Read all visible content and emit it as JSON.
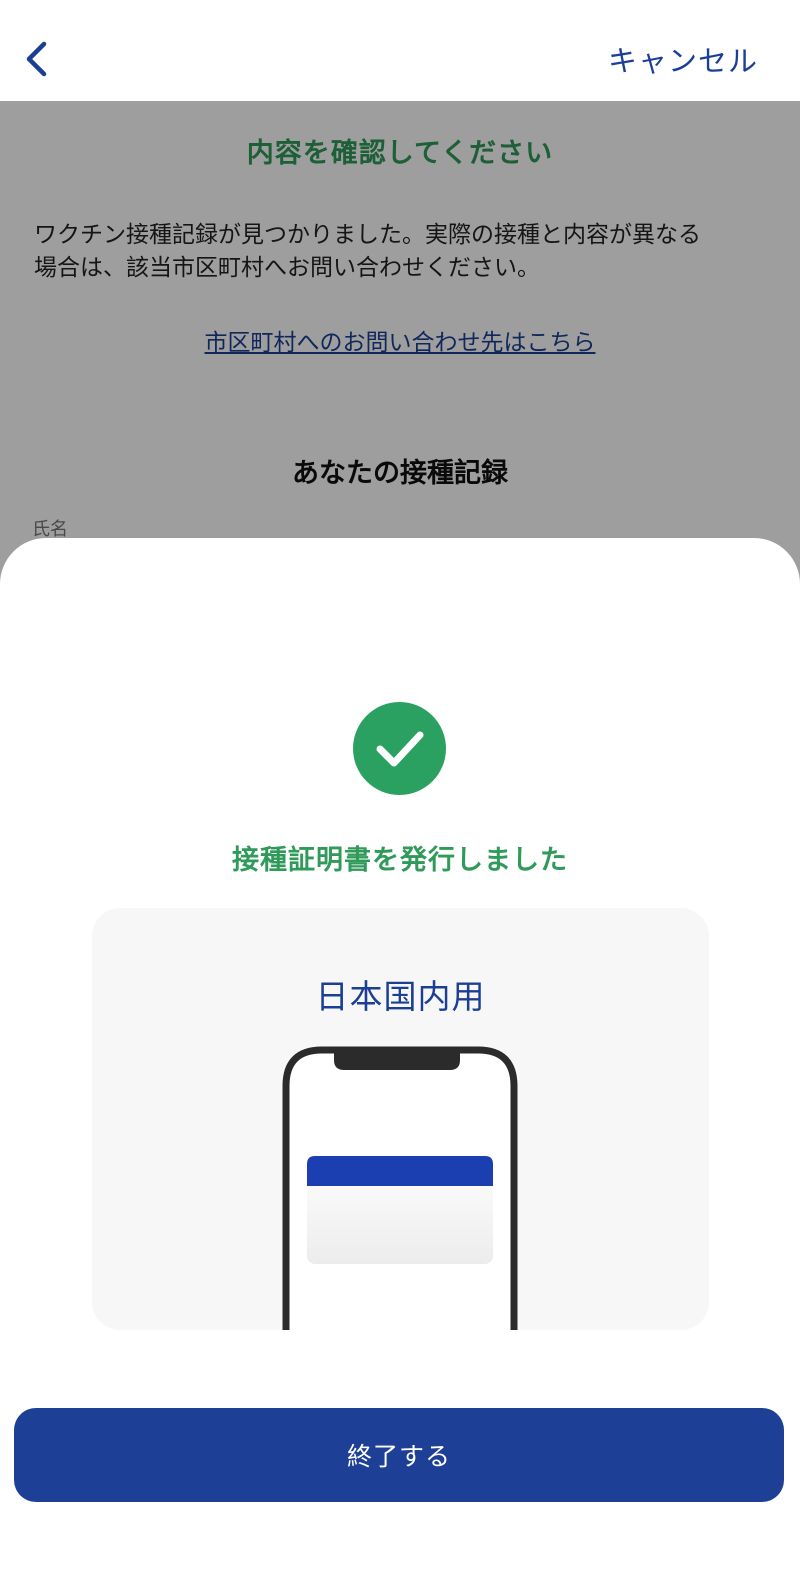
{
  "nav": {
    "back_icon": "chevron-left-icon",
    "cancel_label": "キャンセル"
  },
  "background": {
    "title": "内容を確認してください",
    "description_line1": "ワクチン接種記録が見つかりました。実際の接種と内容が異なる",
    "description_line2": "場合は、該当市区町村へお問い合わせください。",
    "contact_link": "市区町村へのお問い合わせ先はこちら",
    "record_heading": "あなたの接種記録",
    "name_label": "氏名"
  },
  "sheet": {
    "status_icon": "check-circle-icon",
    "message": "接種証明書を発行しました",
    "certificate_type": "日本国内用",
    "finish_label": "終了する"
  },
  "colors": {
    "accent_blue": "#1d3f96",
    "success_green": "#2aa160",
    "title_green": "#2f9a59"
  }
}
